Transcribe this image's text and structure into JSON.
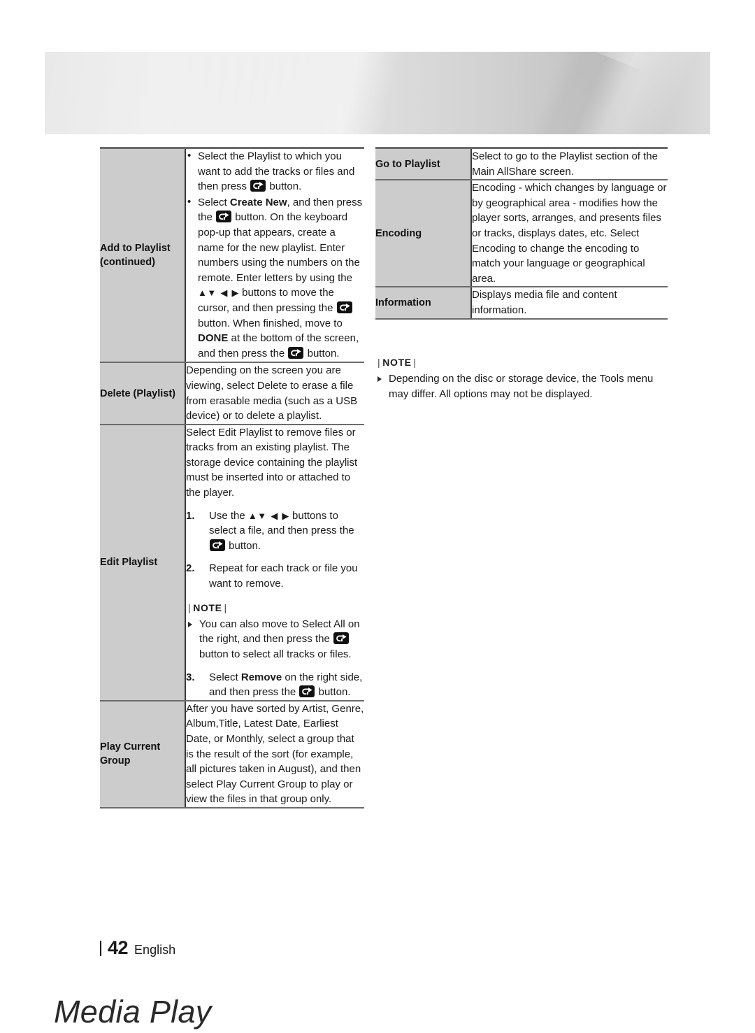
{
  "header": {
    "title": "Media Play"
  },
  "icons": {
    "enter_button": "enter-button-icon",
    "arrows": "▲▼ ◀ ▶"
  },
  "left_table": {
    "rows": [
      {
        "label": "Add to Playlist (continued)",
        "label_line1": "Add to Playlist",
        "label_line2": "(continued)",
        "bullets": [
          {
            "parts": [
              {
                "t": "Select the Playlist to which you want to add the tracks or files and then press "
              },
              {
                "icon": "enter-button-icon"
              },
              {
                "t": " button."
              }
            ]
          },
          {
            "parts": [
              {
                "t": "Select "
              },
              {
                "t": "Create New",
                "bold": true
              },
              {
                "t": ", and then press the "
              },
              {
                "icon": "enter-button-icon"
              },
              {
                "t": " button. On the keyboard pop-up that appears, create a name for the new playlist. Enter numbers using the numbers on the remote. Enter letters by using the "
              },
              {
                "arrows": true
              },
              {
                "t": " buttons to move the cursor, and then pressing the "
              },
              {
                "icon": "enter-button-icon"
              },
              {
                "t": " button. When finished, move to "
              },
              {
                "t": "DONE",
                "bold": true
              },
              {
                "t": " at the bottom of the screen, and then press the "
              },
              {
                "icon": "enter-button-icon"
              },
              {
                "t": " button."
              }
            ]
          }
        ]
      },
      {
        "label": "Delete (Playlist)",
        "text": "Depending on the screen you are viewing, select Delete to erase a file from erasable media (such as a USB device) or to delete a playlist."
      },
      {
        "label": "Edit Playlist",
        "intro": "Select Edit Playlist to remove files or tracks from an existing playlist. The storage device containing the playlist must be inserted into or attached to the player.",
        "steps": [
          {
            "num": "1.",
            "parts": [
              {
                "t": "Use the "
              },
              {
                "arrows": true
              },
              {
                "t": " buttons to select a file, and then press the "
              },
              {
                "icon": "enter-button-icon"
              },
              {
                "t": " button."
              }
            ]
          },
          {
            "num": "2.",
            "parts": [
              {
                "t": "Repeat for each track or file you want to remove."
              }
            ]
          }
        ],
        "note": {
          "head": "NOTE",
          "items": [
            {
              "parts": [
                {
                  "t": "You can also move to Select All on the right, and then press the "
                },
                {
                  "icon": "enter-button-icon"
                },
                {
                  "t": " button to select all tracks or files."
                }
              ]
            }
          ]
        },
        "steps_after": [
          {
            "num": "3.",
            "parts": [
              {
                "t": "Select "
              },
              {
                "t": "Remove",
                "bold": true
              },
              {
                "t": " on the right side, and then press the "
              },
              {
                "icon": "enter-button-icon"
              },
              {
                "t": " button."
              }
            ]
          }
        ]
      },
      {
        "label": "Play Current Group",
        "label_line1": "Play Current",
        "label_line2": "Group",
        "text": "After you have sorted by Artist, Genre, Album,Title, Latest Date, Earliest Date, or Monthly, select a group that is the result of the sort (for example, all pictures taken in August), and then select Play Current Group to play or view the files in that group only."
      }
    ]
  },
  "right_table": {
    "rows": [
      {
        "label": "Go to Playlist",
        "text": "Select to go to the Playlist section of the Main AllShare screen."
      },
      {
        "label": "Encoding",
        "text": "Encoding - which changes by language or by geographical area - modifies how the player sorts, arranges, and presents files or tracks, displays dates, etc. Select Encoding to change the encoding to match your language or geographical area."
      },
      {
        "label": "Information",
        "text": "Displays media file and content information."
      }
    ]
  },
  "right_note": {
    "head": "NOTE",
    "items": [
      "Depending on the disc or storage device, the Tools menu may differ. All options may not be displayed."
    ]
  },
  "footer": {
    "page": "42",
    "language": "English"
  },
  "colors": {
    "label_cell_bg": "#cccccc",
    "rule": "#6b6b6b",
    "text": "#1a1a1a"
  }
}
